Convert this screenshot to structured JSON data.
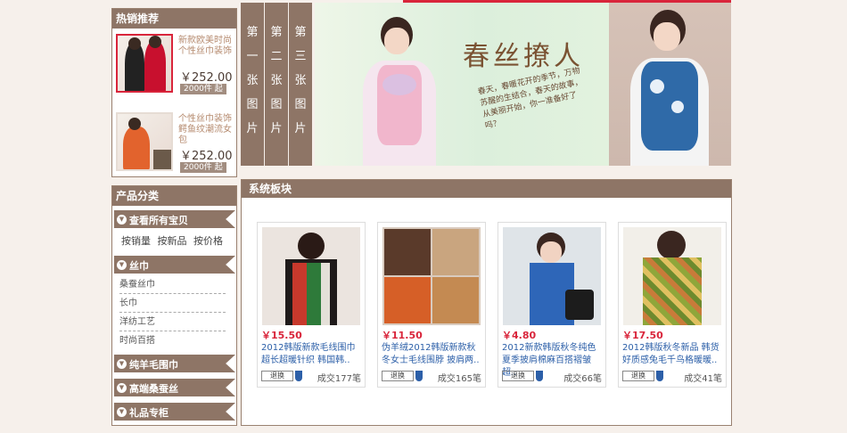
{
  "hot": {
    "title": "热销推荐",
    "items": [
      {
        "name": "新款欧美时尚个性丝巾装饰",
        "price": "￥252.00",
        "min": "2000件 起"
      },
      {
        "name": "个性丝巾装饰鳄鱼纹潮流女包",
        "price": "￥252.00",
        "min": "2000件 起"
      }
    ]
  },
  "category": {
    "title": "产品分类",
    "all": "查看所有宝贝",
    "quick": [
      "按销量",
      "按新品",
      "按价格"
    ],
    "silk": "丝巾",
    "silk_items": [
      "桑蚕丝巾",
      "长巾",
      "洋纺工艺",
      "时尚百搭"
    ],
    "wool": "纯羊毛围巾",
    "premium": "高端桑蚕丝",
    "gift": "礼品专柜"
  },
  "banner": {
    "tabs": [
      [
        "第",
        "一",
        "张",
        "图",
        "片"
      ],
      [
        "第",
        "二",
        "张",
        "图",
        "片"
      ],
      [
        "第",
        "三",
        "张",
        "图",
        "片"
      ]
    ],
    "title": "春丝撩人",
    "poem": "春天，春暖花开的季节，万物苏醒的生结合，春天的故事，从美丽开始，你一准备好了吗？"
  },
  "products": {
    "title": "系统板块",
    "items": [
      {
        "price": "￥15.50",
        "name": "2012韩版新款毛线围巾 超长超暖针织 韩国韩..",
        "badge": "退换",
        "sold": "成交177笔"
      },
      {
        "price": "￥11.50",
        "name": "伪羊绒2012韩版新款秋冬女士毛线围脖 披肩两..",
        "badge": "退换",
        "sold": "成交165笔"
      },
      {
        "price": "￥4.80",
        "name": "2012新款韩版秋冬纯色夏季披肩棉麻百搭褶皱超..",
        "badge": "退换",
        "sold": "成交66笔"
      },
      {
        "price": "￥17.50",
        "name": "2012韩版秋冬新品 韩货好质感兔毛千鸟格暖暖..",
        "badge": "退换",
        "sold": "成交41笔"
      }
    ]
  },
  "colors": {
    "accent": "#8e7566",
    "price": "#d9253b",
    "link": "#2c5fa8"
  }
}
